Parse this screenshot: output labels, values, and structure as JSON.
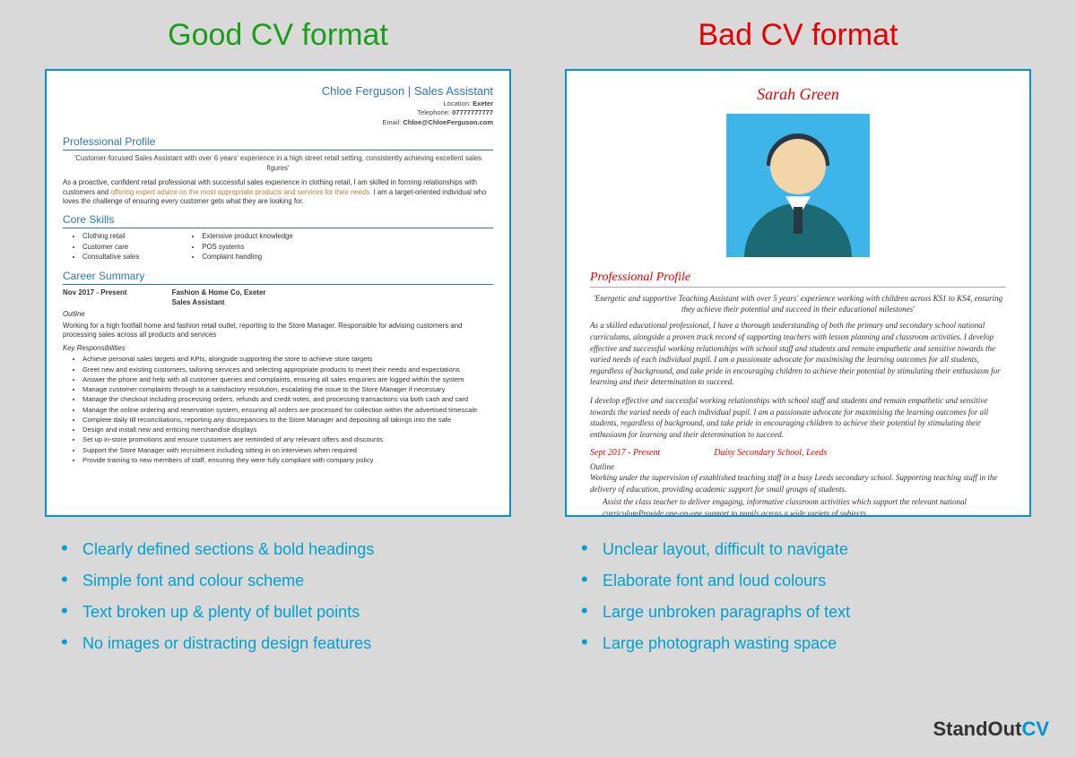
{
  "good": {
    "title": "Good CV format",
    "cv": {
      "name": "Chloe Ferguson | Sales Assistant",
      "location_label": "Location:",
      "location": "Exeter",
      "tel_label": "Telephone:",
      "tel": "07777777777",
      "email_label": "Email:",
      "email": "Chloe@ChloeFerguson.com",
      "profile_h": "Professional Profile",
      "quote": "'Customer-focused Sales Assistant with over 6 years' experience in a high street retail setting, consistently achieving excellent sales figures'",
      "para1_a": "As a proactive, confident retail professional with successful sales experience in clothing retail, I am skilled in forming relationships with customers and ",
      "para1_highlight": "offering expert advice on the most appropriate products and services for their needs.",
      "para1_b": " I am a target-oriented individual who loves the challenge of ensuring every customer gets what they are looking for.",
      "skills_h": "Core Skills",
      "skills_left": [
        "Clothing retail",
        "Customer care",
        "Consultative sales"
      ],
      "skills_right": [
        "Extensive product knowledge",
        "POS systems",
        "Complaint handling"
      ],
      "career_h": "Career Summary",
      "job_date": "Nov 2017 - Present",
      "job_company": "Fashion & Home Co, Exeter",
      "job_title": "Sales Assistant",
      "outline_h": "Outline",
      "outline": "Working for a high footfall home and fashion retail outlet, reporting to the Store Manager. Responsible for advising customers and processing sales across all products and services",
      "resp_h": "Key Responsibilities",
      "resp": [
        "Achieve personal sales targets and KPIs, alongside supporting the store to achieve store targets",
        "Greet new and existing customers, tailoring services and selecting appropriate products to meet their needs and expectations",
        "Answer the phone and help with all customer queries and complaints, ensuring all sales enquiries are logged within the system",
        "Manage customer complaints through to a satisfactory resolution, escalating the issue to the Store Manager if necessary",
        "Manage the checkout including processing orders, refunds and credit notes, and processing transactions via both cash and card",
        "Manage the online ordering and reservation system, ensuring all orders are processed for collection within the advertised timescale",
        "Complete daily till reconciliations, reporting any discrepancies to the Store Manager and depositing all takings into the safe",
        "Design and install new and enticing merchandise displays",
        "Set up in-store promotions and ensure customers are reminded of any relevant offers and discounts",
        "Support the Store Manager with recruitment including sitting in on interviews when required",
        "Provide training to new members of staff, ensuring they were fully compliant with company policy"
      ]
    },
    "bullets": [
      "Clearly defined sections & bold headings",
      "Simple font and colour scheme",
      "Text broken up & plenty of bullet points",
      "No images or distracting design features"
    ]
  },
  "bad": {
    "title": "Bad CV format",
    "cv": {
      "name": "Sarah Green",
      "profile_h": "Professional Profile",
      "quote": "'Energetic and supportive Teaching Assistant with over 5 years' experience working with children across KS1 to KS4, ensuring they achieve their potential and succeed in their educational milestones'",
      "para1": "As a skilled educational professional, I have a thorough understanding of both the primary and secondary school national curriculums, alongside a proven track record of supporting teachers with lesson planning and classroom activities. I develop effective and successful working relationships with school staff and students and remain empathetic and sensitive towards the varied needs of each individual pupil. I am a passionate advocate for maximising the learning outcomes for all students, regardless of background, and take pride in encouraging children to achieve their potential by stimulating their enthusiasm for learning and their determination to succeed.",
      "para2": "I develop effective and successful working relationships with school staff and students and remain empathetic and sensitive towards the varied needs of each individual pupil. I am a passionate advocate for maximising the learning outcomes for all students, regardless of background, and take pride in encouraging children to achieve their potential by stimulating their enthusiasm for learning and their determination to succeed.",
      "job_date": "Sept 2017 - Present",
      "job_company": "Daisy Secondary School, Leeds",
      "outline_h": "Outline",
      "outline": "Working under the supervision of established teaching staff in a busy Leeds secondary school. Supporting teaching staff in the delivery of education, providing academic support for small groups of students.",
      "resp1": "Assist the class teacher to deliver engaging, informative classroom activities which support the relevant national curriculumProvide one-on-one support to pupils across a wide variety of subjects"
    },
    "bullets": [
      "Unclear layout, difficult to navigate",
      "Elaborate font and loud colours",
      "Large unbroken paragraphs of text",
      "Large photograph wasting space"
    ]
  },
  "logo": {
    "stand": "StandOut",
    "cv": "CV"
  }
}
